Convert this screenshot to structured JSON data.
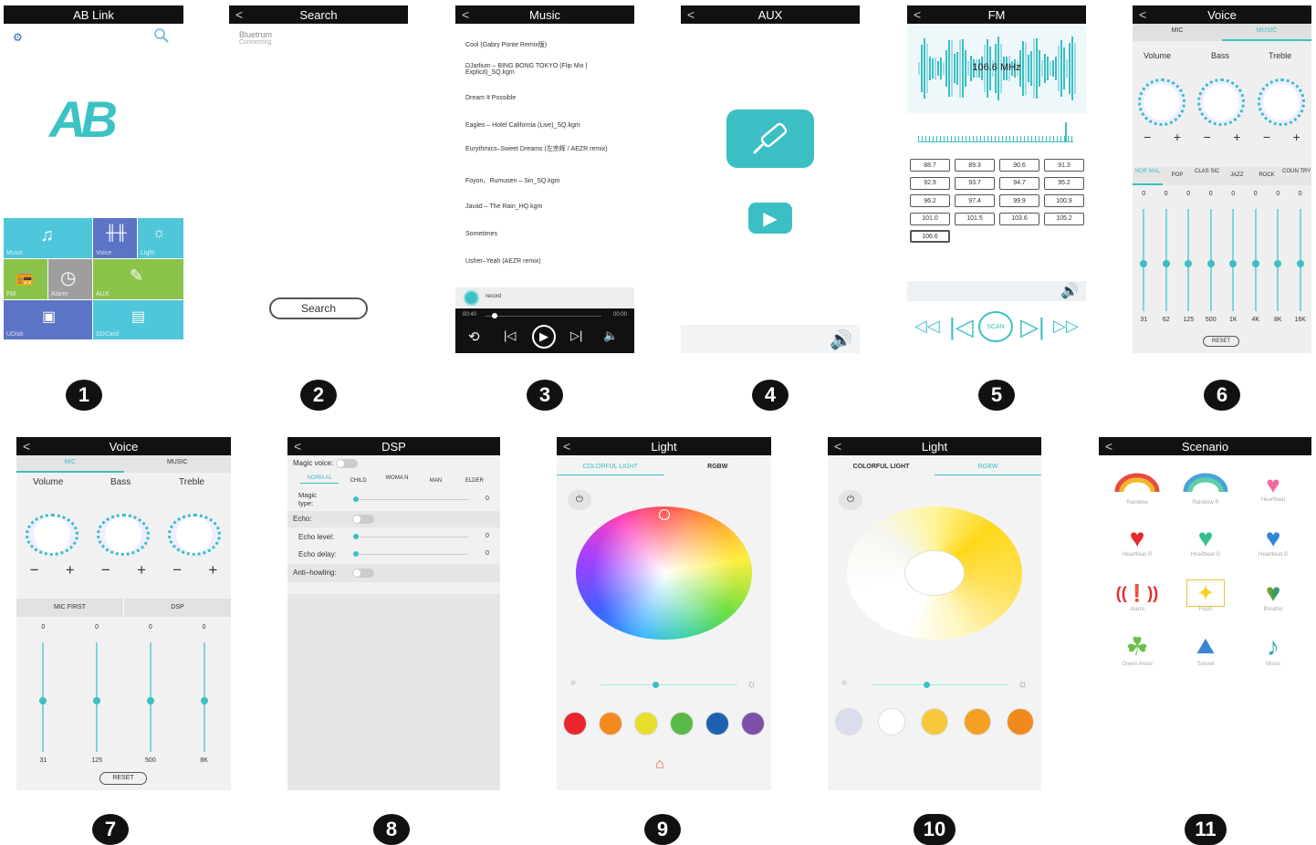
{
  "numbers": [
    "1",
    "2",
    "3",
    "4",
    "5",
    "6",
    "7",
    "8",
    "9",
    "10",
    "11"
  ],
  "p1": {
    "title": "AB Link",
    "logo": "AB",
    "tiles": [
      "Music",
      "Voice",
      "Light",
      "FM",
      "Alarm",
      "AUX",
      "UDisk",
      "SDCard"
    ]
  },
  "p2": {
    "title": "Search",
    "device_name": "Bluetrum",
    "device_status": "Connecting",
    "search_button": "Search"
  },
  "p3": {
    "title": "Music",
    "songs": [
      "Cool (Gabry Ponte Remix版)",
      "DJarlium – BING BONG TOKYO (Flip Mix | Explicit)_SQ.kgm",
      "Dream It Possible",
      "Eagles – Hotel California (Live)_SQ.kgm",
      "Eurythmics–Sweet Dreams (左宗辉 / AEZR remix)",
      "Foyon、Rumusen – Sin_SQ.kgm",
      "Javad – The Rain_HQ.kgm",
      "Sometimes",
      "Usher–Yeah (AEZR remix)"
    ],
    "record_label": "record",
    "time_start": "00:40",
    "time_end": "00:00",
    "progress": 0.06
  },
  "p4": {
    "title": "AUX"
  },
  "p5": {
    "title": "FM",
    "frequency": "106.6 MHz",
    "presets": [
      "88.7",
      "89.3",
      "90.6",
      "91.3",
      "92.9",
      "93.7",
      "94.7",
      "95.2",
      "96.2",
      "97.4",
      "99.9",
      "100.9",
      "101.0",
      "101.5",
      "103.6",
      "105.2",
      "106.6"
    ],
    "scan_label": "SCAN"
  },
  "p6": {
    "title": "Voice",
    "tabs": [
      "MIC",
      "MUSIC"
    ],
    "knob_labels": [
      "Volume",
      "Bass",
      "Treble"
    ],
    "eq_modes": [
      "NOR MAL",
      "POP",
      "CLAS SIC",
      "JAZZ",
      "ROCK",
      "COUN TRY"
    ],
    "eq_values": [
      "0",
      "0",
      "0",
      "0",
      "0",
      "0",
      "0",
      "0"
    ],
    "eq_freqs": [
      "31",
      "62",
      "125",
      "500",
      "1K",
      "4K",
      "8K",
      "16K"
    ],
    "reset": "RESET"
  },
  "p7": {
    "title": "Voice",
    "tabs": [
      "MIC",
      "MUSIC"
    ],
    "knob_labels": [
      "Volume",
      "Bass",
      "Treble"
    ],
    "section_tabs": [
      "MIC FIRST",
      "DSP"
    ],
    "eq_values": [
      "0",
      "0",
      "0",
      "0"
    ],
    "eq_freqs": [
      "31",
      "125",
      "500",
      "8K"
    ],
    "reset": "RESET"
  },
  "p8": {
    "title": "DSP",
    "magic_voice": "Magic voice:",
    "voice_types": [
      "NORM AL",
      "CHILD",
      "WOMA N",
      "MAN",
      "ELDER"
    ],
    "magic_type": "Magic type:",
    "magic_type_value": "0",
    "echo": "Echo:",
    "echo_level": "Echo level:",
    "echo_level_value": "0",
    "echo_delay": "Echo delay:",
    "echo_delay_value": "0",
    "anti_howling": "Anti–howling:"
  },
  "p9": {
    "title": "Light",
    "tabs": [
      "COLORFUL LIGHT",
      "RGBW"
    ],
    "swatches": [
      "#e8262b",
      "#f28a1f",
      "#e8df2c",
      "#58b947",
      "#1e61b0",
      "#7c4fa8"
    ]
  },
  "p10": {
    "title": "Light",
    "tabs": [
      "COLORFUL LIGHT",
      "RGBW"
    ],
    "swatches": [
      "#dcdcef",
      "#ffffff",
      "#f7c83a",
      "#f4a024",
      "#f08a1c"
    ]
  },
  "p11": {
    "title": "Scenario",
    "items": [
      "Rainbow",
      "Rainbow R",
      "Heartbeat",
      "Heartbeat R",
      "Heartbeat G",
      "Heartbeat B",
      "Alarm",
      "Flash",
      "Breathe",
      "Green mood",
      "Sunset",
      "Music"
    ]
  }
}
